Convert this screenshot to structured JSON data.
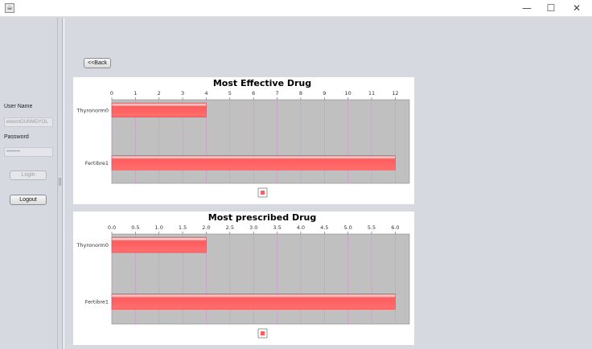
{
  "window": {
    "icon": "java-cup-icon",
    "controls": {
      "minimize": "—",
      "maximize": "☐",
      "close": "✕"
    }
  },
  "login": {
    "username_label": "User Name",
    "username_value": "elwoniOUNMDYOL",
    "password_label": "Password",
    "password_value": "••••••••",
    "login_button": "Login",
    "logout_button": "Logout"
  },
  "main": {
    "back_button": "<<Back"
  },
  "colors": {
    "bar": "#ff5c5c",
    "bar_highlight": "#ffe0e0",
    "plot_background": "#c0c0c0",
    "gridline": "#cc99cc"
  },
  "chart_data": [
    {
      "type": "bar",
      "orientation": "horizontal",
      "title": "Most Effective Drug",
      "categories": [
        "Thyronorm0",
        "Fertibre1"
      ],
      "values": [
        4,
        12
      ],
      "xlim": [
        0,
        12.6
      ],
      "ticks": [
        "0",
        "1",
        "2",
        "3",
        "4",
        "5",
        "6",
        "7",
        "8",
        "9",
        "10",
        "11",
        "12"
      ],
      "tick_values": [
        0,
        1,
        2,
        3,
        4,
        5,
        6,
        7,
        8,
        9,
        10,
        11,
        12
      ],
      "grid": true,
      "legend": "bottom-center"
    },
    {
      "type": "bar",
      "orientation": "horizontal",
      "title": "Most prescribed Drug",
      "categories": [
        "Thyronorm0",
        "Fertibre1"
      ],
      "values": [
        2.0,
        6.0
      ],
      "xlim": [
        0,
        6.3
      ],
      "ticks": [
        "0.0",
        "0.5",
        "1.0",
        "1.5",
        "2.0",
        "2.5",
        "3.0",
        "3.5",
        "4.0",
        "4.5",
        "5.0",
        "5.5",
        "6.0"
      ],
      "tick_values": [
        0,
        0.5,
        1.0,
        1.5,
        2.0,
        2.5,
        3.0,
        3.5,
        4.0,
        4.5,
        5.0,
        5.5,
        6.0
      ],
      "grid": true,
      "legend": "bottom-center"
    }
  ]
}
